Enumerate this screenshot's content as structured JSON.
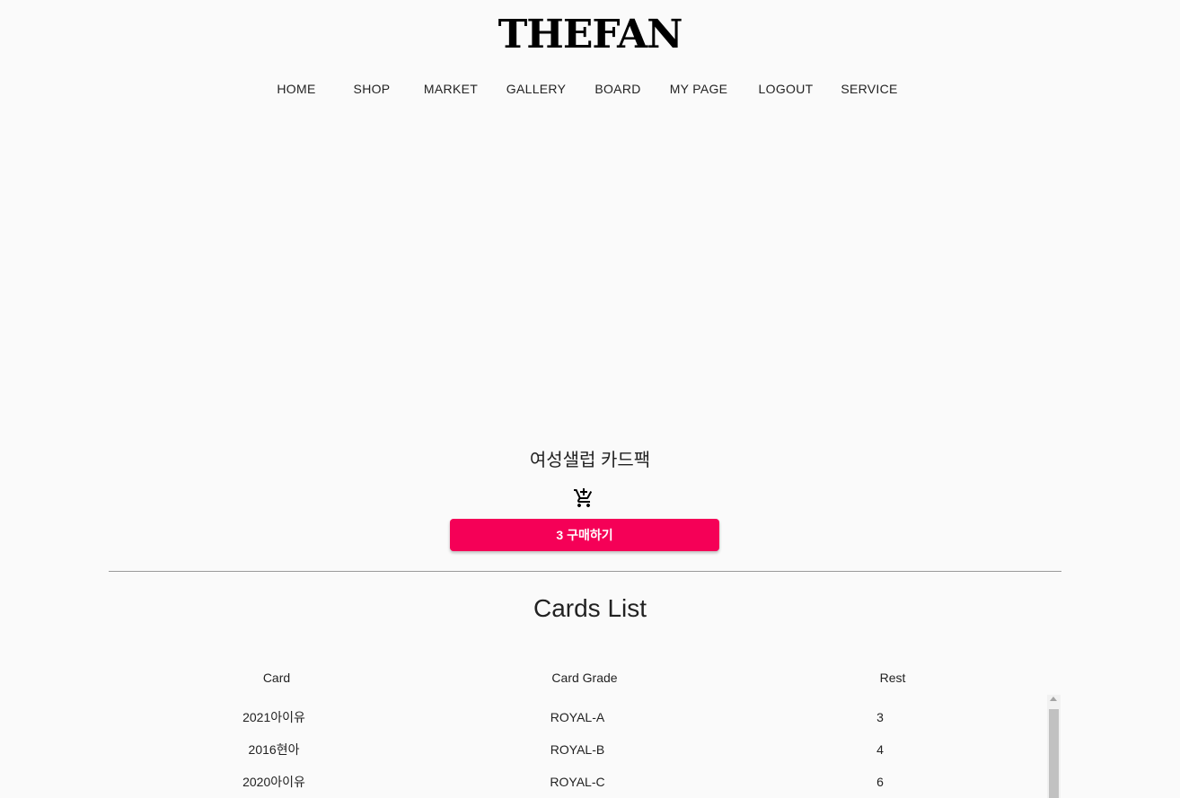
{
  "brand": {
    "logo_text": "THEFAN"
  },
  "nav": {
    "items": [
      {
        "id": "home",
        "label": "HOME"
      },
      {
        "id": "shop",
        "label": "SHOP"
      },
      {
        "id": "market",
        "label": "MARKET"
      },
      {
        "id": "gallery",
        "label": "GALLERY"
      },
      {
        "id": "board",
        "label": "BOARD"
      },
      {
        "id": "mypage",
        "label": "MY PAGE"
      },
      {
        "id": "logout",
        "label": "LOGOUT"
      },
      {
        "id": "service",
        "label": "SERVICE"
      }
    ]
  },
  "product": {
    "title": "여성샐럽 카드팩",
    "cart_icon": "add-shopping-cart-icon",
    "buy_label": "3 구매하기"
  },
  "cards_list": {
    "title": "Cards List",
    "columns": [
      "Card",
      "Card Grade",
      "Rest"
    ],
    "rows": [
      [
        "2021아이유",
        "ROYAL-A",
        "3"
      ],
      [
        "2016현아",
        "ROYAL-B",
        "4"
      ],
      [
        "2020아이유",
        "ROYAL-C",
        "6"
      ]
    ]
  },
  "colors": {
    "accent": "#f50057",
    "background": "#fafafa",
    "divider": "#999999"
  }
}
